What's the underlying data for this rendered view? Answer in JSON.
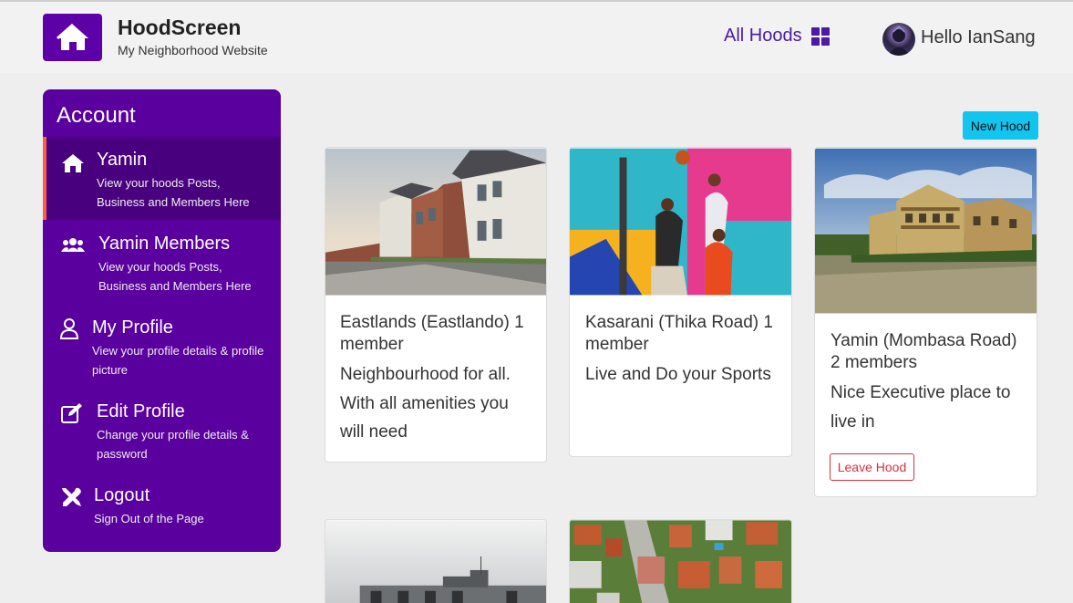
{
  "header": {
    "brand_name": "HoodScreen",
    "brand_tagline": "My Neighborhood Website",
    "all_hoods_label": "All Hoods",
    "greeting": "Hello IanSang"
  },
  "sidebar": {
    "title": "Account",
    "items": [
      {
        "label": "Yamin",
        "desc": "View your hoods Posts, Business and Members Here",
        "icon": "home-icon",
        "active": true
      },
      {
        "label": "Yamin Members",
        "desc": "View your hoods Posts, Business and Members Here",
        "icon": "users-icon",
        "active": false
      },
      {
        "label": "My Profile",
        "desc": "View your profile details & profile picture",
        "icon": "user-icon",
        "active": false
      },
      {
        "label": "Edit Profile",
        "desc": "Change your profile details & password",
        "icon": "edit-icon",
        "active": false
      },
      {
        "label": "Logout",
        "desc": "Sign Out of the Page",
        "icon": "tools-icon",
        "active": false
      }
    ]
  },
  "main": {
    "new_hood_label": "New Hood",
    "cards": [
      {
        "title": "Eastlands (Eastlando) 1 member",
        "text": "Neighbourhood for all. With all amenities you will need",
        "image": "suburban-houses-photo"
      },
      {
        "title": "Kasarani (Thika Road) 1 member",
        "text": "Live and Do your Sports",
        "image": "basketball-players-photo"
      },
      {
        "title": "Yamin (Mombasa Road) 2 members",
        "text": "Nice Executive place to live in",
        "image": "executive-apartments-photo",
        "button": "Leave Hood"
      },
      {
        "image": "apartment-building-photo"
      },
      {
        "image": "aerial-houses-photo"
      }
    ]
  },
  "colors": {
    "brand_purple": "#5d00a7",
    "sidebar_purple": "#5a009e",
    "active_border": "#ff5a4e",
    "new_hood_button": "#11c5ee",
    "leave_button": "#d5323f",
    "link_purple": "#4b1aa6"
  }
}
